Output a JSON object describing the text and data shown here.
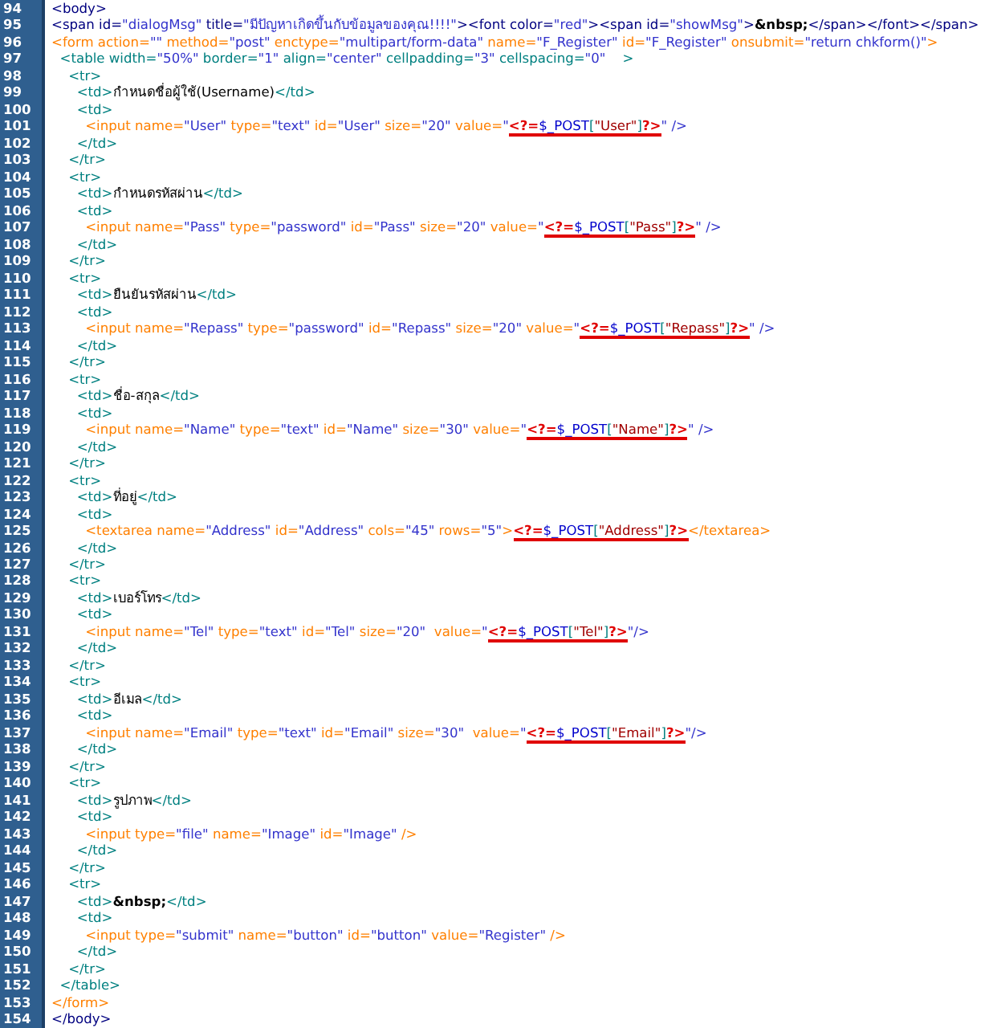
{
  "editor": {
    "lines": [
      {
        "number": "94",
        "code": "<body>",
        "color": "#000080"
      },
      {
        "number": "95",
        "code": "<span id=\"dialogMsg\" title=\"มีปัญหาเกิดขึ้นกับข้อมูลของคุณ!!!!\"><font color=\"red\"><span id=\"showMsg\">&nbsp;</span></font></span>",
        "color": "#000080"
      },
      {
        "number": "96",
        "code": "<form action=\"\" method=\"post\" enctype=\"multipart/form-data\" name=\"F_Register\" id=\"F_Register\" onsubmit=\"return chkform()\">",
        "color": "#ff8000"
      },
      {
        "number": "97",
        "code": "  <table width=\"50%\" border=\"1\" align=\"center\" cellpadding=\"3\" cellspacing=\"0\"    >",
        "color": "#008080"
      },
      {
        "number": "98",
        "code": "    <tr>",
        "color": "#008080"
      },
      {
        "number": "99",
        "code": "      <td>กำหนดชื่อผู้ใช้(Username)</td>",
        "color": "#008080"
      },
      {
        "number": "100",
        "code": "      <td>",
        "color": "#008080"
      },
      {
        "number": "101",
        "code": "        <input name=\"User\" type=\"text\" id=\"User\" size=\"20\" value=\"<?=$_POST[\"User\"]?>\" />",
        "color": "#ff8000",
        "underlined": true
      },
      {
        "number": "102",
        "code": "      </td>",
        "color": "#008080"
      },
      {
        "number": "103",
        "code": "    </tr>",
        "color": "#008080"
      },
      {
        "number": "104",
        "code": "    <tr>",
        "color": "#008080"
      },
      {
        "number": "105",
        "code": "      <td>กำหนดรหัสผ่าน</td>",
        "color": "#008080"
      },
      {
        "number": "106",
        "code": "      <td>",
        "color": "#008080"
      },
      {
        "number": "107",
        "code": "        <input name=\"Pass\" type=\"password\" id=\"Pass\" size=\"20\" value=\"<?=$_POST[\"Pass\"]?>\" />",
        "color": "#ff8000",
        "underlined": true
      },
      {
        "number": "108",
        "code": "      </td>",
        "color": "#008080"
      },
      {
        "number": "109",
        "code": "    </tr>",
        "color": "#008080"
      },
      {
        "number": "110",
        "code": "    <tr>",
        "color": "#008080"
      },
      {
        "number": "111",
        "code": "      <td>ยืนยันรหัสผ่าน</td>",
        "color": "#008080"
      },
      {
        "number": "112",
        "code": "      <td>",
        "color": "#008080"
      },
      {
        "number": "113",
        "code": "        <input name=\"Repass\" type=\"password\" id=\"Repass\" size=\"20\" value=\"<?=$_POST[\"Repass\"]?>\" />",
        "color": "#ff8000",
        "underlined": true
      },
      {
        "number": "114",
        "code": "      </td>",
        "color": "#008080"
      },
      {
        "number": "115",
        "code": "    </tr>",
        "color": "#008080"
      },
      {
        "number": "116",
        "code": "    <tr>",
        "color": "#008080"
      },
      {
        "number": "117",
        "code": "      <td>ชื่อ-สกุล</td>",
        "color": "#008080"
      },
      {
        "number": "118",
        "code": "      <td>",
        "color": "#008080"
      },
      {
        "number": "119",
        "code": "        <input name=\"Name\" type=\"text\" id=\"Name\" size=\"30\" value=\"<?=$_POST[\"Name\"]?>\" />",
        "color": "#ff8000",
        "underlined": true
      },
      {
        "number": "120",
        "code": "      </td>",
        "color": "#008080"
      },
      {
        "number": "121",
        "code": "    </tr>",
        "color": "#008080"
      },
      {
        "number": "122",
        "code": "    <tr>",
        "color": "#008080"
      },
      {
        "number": "123",
        "code": "      <td>ที่อยู่</td>",
        "color": "#008080"
      },
      {
        "number": "124",
        "code": "      <td>",
        "color": "#008080"
      },
      {
        "number": "125",
        "code": "        <textarea name=\"Address\" id=\"Address\" cols=\"45\" rows=\"5\"><?=$_POST[\"Address\"]?></textarea>",
        "color": "#ff8000",
        "underlined": true
      },
      {
        "number": "126",
        "code": "      </td>",
        "color": "#008080"
      },
      {
        "number": "127",
        "code": "    </tr>",
        "color": "#008080"
      },
      {
        "number": "128",
        "code": "    <tr>",
        "color": "#008080"
      },
      {
        "number": "129",
        "code": "      <td>เบอร์โทร</td>",
        "color": "#008080"
      },
      {
        "number": "130",
        "code": "      <td>",
        "color": "#008080"
      },
      {
        "number": "131",
        "code": "        <input name=\"Tel\" type=\"text\" id=\"Tel\" size=\"20\"  value=\"<?=$_POST[\"Tel\"]?>\"/>",
        "color": "#ff8000",
        "underlined": true
      },
      {
        "number": "132",
        "code": "      </td>",
        "color": "#008080"
      },
      {
        "number": "133",
        "code": "    </tr>",
        "color": "#008080"
      },
      {
        "number": "134",
        "code": "    <tr>",
        "color": "#008080"
      },
      {
        "number": "135",
        "code": "      <td>อีเมล</td>",
        "color": "#008080"
      },
      {
        "number": "136",
        "code": "      <td>",
        "color": "#008080"
      },
      {
        "number": "137",
        "code": "        <input name=\"Email\" type=\"text\" id=\"Email\" size=\"30\"  value=\"<?=$_POST[\"Email\"]?>\"/>",
        "color": "#ff8000",
        "underlined": true
      },
      {
        "number": "138",
        "code": "      </td>",
        "color": "#008080"
      },
      {
        "number": "139",
        "code": "    </tr>",
        "color": "#008080"
      },
      {
        "number": "140",
        "code": "    <tr>",
        "color": "#008080"
      },
      {
        "number": "141",
        "code": "      <td>รูปภาพ</td>",
        "color": "#008080"
      },
      {
        "number": "142",
        "code": "      <td>",
        "color": "#008080"
      },
      {
        "number": "143",
        "code": "        <input type=\"file\" name=\"Image\" id=\"Image\" />",
        "color": "#ff8000"
      },
      {
        "number": "144",
        "code": "      </td>",
        "color": "#008080"
      },
      {
        "number": "145",
        "code": "    </tr>",
        "color": "#008080"
      },
      {
        "number": "146",
        "code": "    <tr>",
        "color": "#008080"
      },
      {
        "number": "147",
        "code": "      <td>&nbsp;</td>",
        "color": "#008080"
      },
      {
        "number": "148",
        "code": "      <td>",
        "color": "#008080"
      },
      {
        "number": "149",
        "code": "        <input type=\"submit\" name=\"button\" id=\"button\" value=\"Register\" />",
        "color": "#ff8000"
      },
      {
        "number": "150",
        "code": "      </td>",
        "color": "#008080"
      },
      {
        "number": "151",
        "code": "    </tr>",
        "color": "#008080"
      },
      {
        "number": "152",
        "code": "  </table>",
        "color": "#008080"
      },
      {
        "number": "153",
        "code": "</form>",
        "color": "#ff8000"
      },
      {
        "number": "154",
        "code": "</body>",
        "color": "#000080"
      }
    ]
  }
}
